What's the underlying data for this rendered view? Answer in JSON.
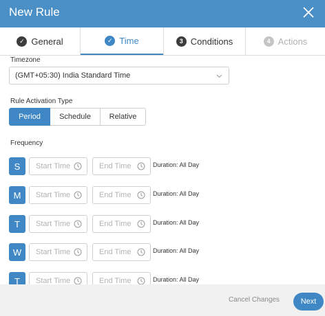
{
  "header": {
    "title": "New Rule",
    "close_icon": "close-icon"
  },
  "tabs": [
    {
      "num": "✓",
      "label": "General",
      "state": "done"
    },
    {
      "num": "✓",
      "label": "Time",
      "state": "active"
    },
    {
      "num": "3",
      "label": "Conditions",
      "state": "pending"
    },
    {
      "num": "4",
      "label": "Actions",
      "state": "disabled"
    }
  ],
  "timezone": {
    "label": "Timezone",
    "value": "(GMT+05:30) India Standard Time"
  },
  "activation": {
    "label": "Rule Activation Type",
    "options": [
      "Period",
      "Schedule",
      "Relative"
    ],
    "selected": "Period"
  },
  "frequency": {
    "label": "Frequency",
    "rows": [
      {
        "day": "S",
        "start_placeholder": "Start Time",
        "end_placeholder": "End Time",
        "duration": "Duration: All Day"
      },
      {
        "day": "M",
        "start_placeholder": "Start Time",
        "end_placeholder": "End Time",
        "duration": "Duration: All Day"
      },
      {
        "day": "T",
        "start_placeholder": "Start Time",
        "end_placeholder": "End Time",
        "duration": "Duration: All Day"
      },
      {
        "day": "W",
        "start_placeholder": "Start Time",
        "end_placeholder": "End Time",
        "duration": "Duration: All Day"
      },
      {
        "day": "T",
        "start_placeholder": "Start Time",
        "end_placeholder": "End Time",
        "duration": "Duration: All Day"
      }
    ]
  },
  "footer": {
    "cancel_label": "Cancel Changes",
    "next_label": "Next"
  },
  "colors": {
    "header": "#4a8fc6",
    "accent": "#3f88c5",
    "footer": "#f1f1f1"
  }
}
